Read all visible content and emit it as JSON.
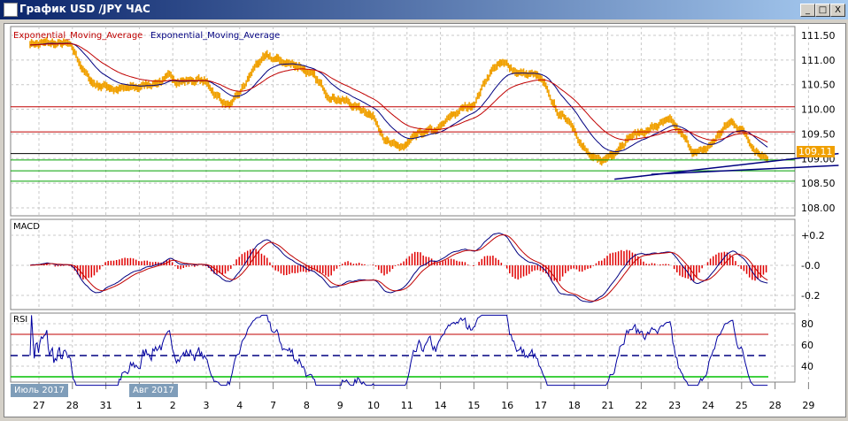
{
  "window": {
    "title": "График USD /JPY  ЧАС",
    "minimize": "_",
    "maximize": "□",
    "close": "X"
  },
  "legend": {
    "ema1": "Exponential_Moving_Average",
    "ema2": "Exponential_Moving_Average"
  },
  "colors": {
    "price": "#f0a000",
    "ema_fast": "#000080",
    "ema_slow": "#c00000",
    "resistance": "#c00000",
    "support": "#00a000",
    "trend": "#000080"
  },
  "current_price": "109.11",
  "panels": {
    "macd": "MACD",
    "rsi": "RSI"
  },
  "month_labels": [
    "Июль 2017",
    "Авг 2017"
  ],
  "chart_data": [
    {
      "type": "line",
      "title": "USD/JPY H1",
      "ylim": [
        108.0,
        111.6
      ],
      "yticks": [
        "111.50",
        "111.00",
        "110.50",
        "110.00",
        "109.50",
        "109.00",
        "108.50",
        "108.00"
      ],
      "ytick_values": [
        111.5,
        111.0,
        110.5,
        110.0,
        109.5,
        109.0,
        108.5,
        108.0
      ],
      "xticks": [
        "27",
        "28",
        "31",
        "1",
        "2",
        "3",
        "4",
        "7",
        "8",
        "9",
        "10",
        "11",
        "14",
        "15",
        "16",
        "17",
        "18",
        "21",
        "22",
        "23",
        "24",
        "25",
        "28",
        "29"
      ],
      "price_waypoints": [
        111.35,
        111.3,
        110.5,
        110.4,
        110.6,
        110.6,
        110.1,
        111.0,
        110.9,
        110.3,
        110.0,
        109.2,
        109.5,
        110.0,
        110.9,
        110.7,
        109.8,
        108.9,
        109.5,
        109.7,
        109.1,
        109.7,
        109.1
      ],
      "hlines": [
        {
          "value": 110.05,
          "color": "#c00000"
        },
        {
          "value": 109.54,
          "color": "#c00000"
        },
        {
          "value": 109.1,
          "color": "#000000"
        },
        {
          "value": 108.97,
          "color": "#00a000"
        },
        {
          "value": 108.75,
          "color": "#00a000"
        },
        {
          "value": 108.54,
          "color": "#00a000"
        }
      ],
      "trendlines": [
        {
          "from": [
            17.2,
            108.58
          ],
          "to": [
            23.9,
            109.1
          ]
        },
        {
          "from": [
            18.3,
            108.68
          ],
          "to": [
            23.9,
            108.86
          ]
        }
      ]
    },
    {
      "type": "bar+line",
      "title": "MACD",
      "ylim": [
        -0.3,
        0.3
      ],
      "yticks": [
        "+0.2",
        "-0.0",
        "-0.2"
      ],
      "ytick_values": [
        0.2,
        0,
        -0.2
      ]
    },
    {
      "type": "line",
      "title": "RSI",
      "ylim": [
        20,
        90
      ],
      "yticks": [
        "80",
        "60",
        "40"
      ],
      "ytick_values": [
        80,
        60,
        40
      ],
      "levels": [
        70,
        50,
        30
      ]
    }
  ]
}
